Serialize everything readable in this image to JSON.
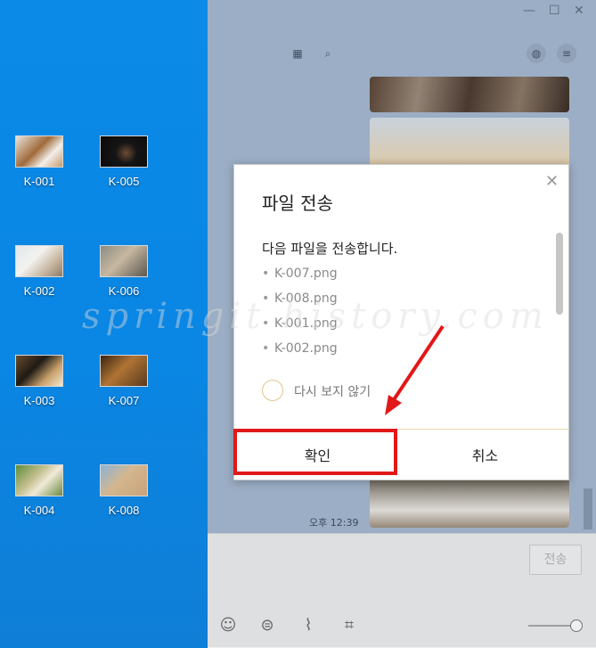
{
  "desktop": {
    "icons": [
      {
        "label": "K-001"
      },
      {
        "label": "K-002"
      },
      {
        "label": "K-003"
      },
      {
        "label": "K-004"
      },
      {
        "label": "K-005"
      },
      {
        "label": "K-006"
      },
      {
        "label": "K-007"
      },
      {
        "label": "K-008"
      }
    ]
  },
  "chat": {
    "time": "오후 12:39",
    "send_label": "전송"
  },
  "dialog": {
    "title": "파일 전송",
    "close_glyph": "✕",
    "message": "다음 파일을 전송합니다.",
    "files": [
      "K-007.png",
      "K-008.png",
      "K-001.png",
      "K-002.png"
    ],
    "dont_show_again": "다시 보지 않기",
    "ok_label": "확인",
    "cancel_label": "취소"
  },
  "watermark": "springit history.com",
  "colors": {
    "highlight": "#e11818",
    "desktop": "#0a86e4",
    "checkbox_border": "#e2c68c"
  }
}
